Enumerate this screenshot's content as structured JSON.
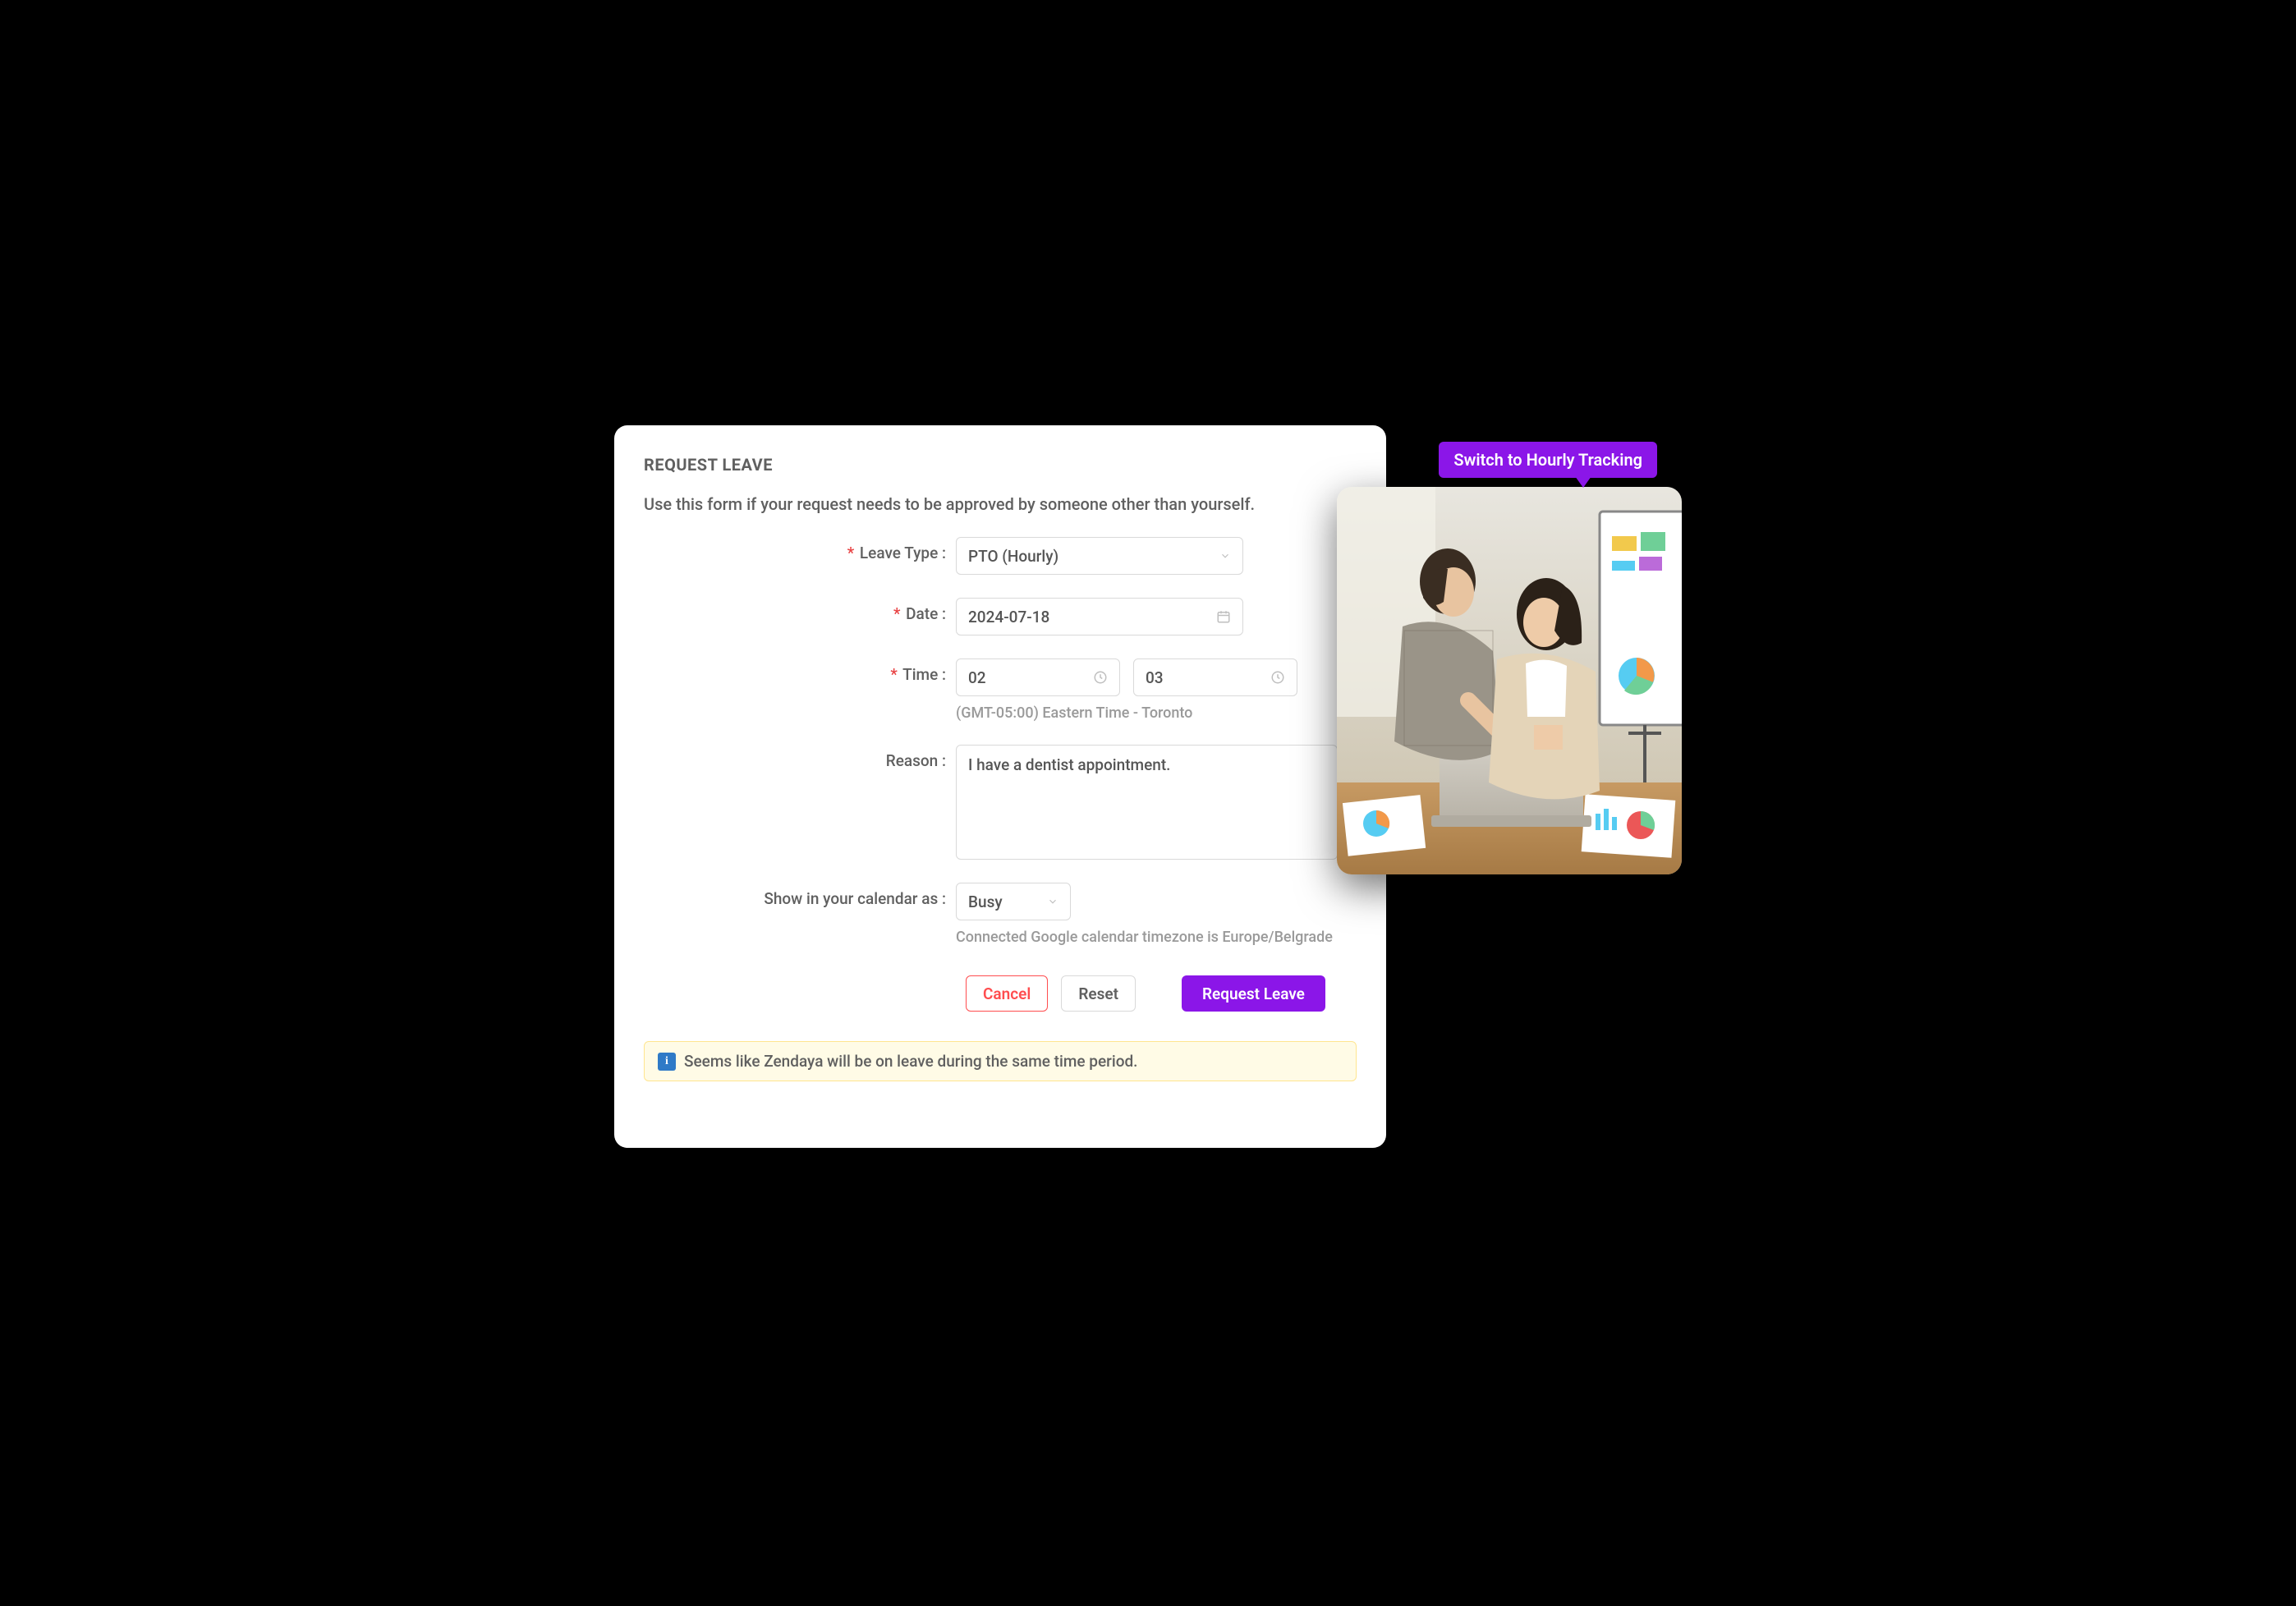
{
  "form": {
    "title": "REQUEST LEAVE",
    "subtitle": "Use this form if your request needs to be approved by someone other than yourself.",
    "fields": {
      "leave_type": {
        "label": "Leave Type :",
        "value": "PTO (Hourly)"
      },
      "date": {
        "label": "Date :",
        "value": "2024-07-18"
      },
      "time": {
        "label": "Time :",
        "start": "02",
        "end": "03",
        "timezone_note": "(GMT-05:00) Eastern Time - Toronto"
      },
      "reason": {
        "label": "Reason :",
        "value": "I have a dentist appointment."
      },
      "calendar": {
        "label": "Show in your calendar as :",
        "value": "Busy",
        "note": "Connected Google calendar timezone is Europe/Belgrade"
      }
    },
    "actions": {
      "cancel": "Cancel",
      "reset": "Reset",
      "submit": "Request Leave"
    },
    "info_banner": "Seems like Zendaya will be on leave during the same time period."
  },
  "callout": "Switch to Hourly Tracking",
  "colors": {
    "accent": "#8b16e8",
    "danger": "#ff4d4f",
    "border": "#d9d9d9",
    "text_muted": "#9a9a9a",
    "text": "#606060",
    "banner_bg": "#fffbe6",
    "banner_border": "#ffe58f"
  }
}
